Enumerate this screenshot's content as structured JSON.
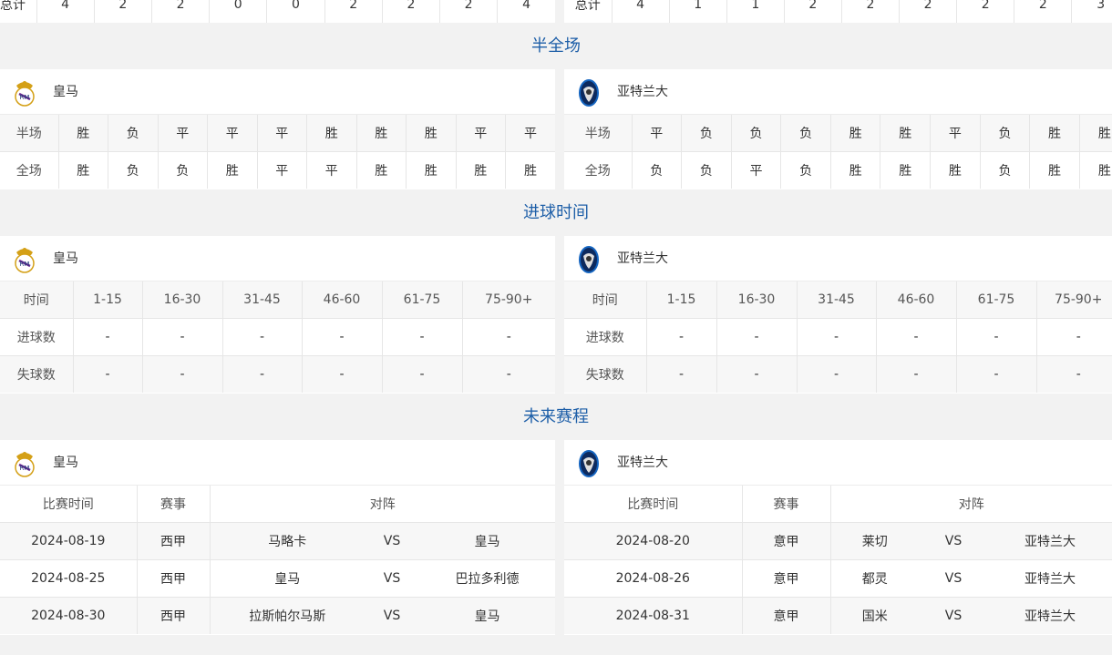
{
  "totals": {
    "left": {
      "label": "总计",
      "values": [
        "4",
        "2",
        "2",
        "0",
        "0",
        "2",
        "2",
        "2",
        "4"
      ]
    },
    "right": {
      "label": "总计",
      "values": [
        "4",
        "1",
        "1",
        "2",
        "2",
        "2",
        "2",
        "2",
        "3"
      ]
    }
  },
  "sections": {
    "halffull_title": "半全场",
    "goaltime_title": "进球时间",
    "future_title": "未来赛程"
  },
  "teams": {
    "home": {
      "name": "皇马"
    },
    "away": {
      "name": "亚特兰大"
    }
  },
  "halffull": {
    "home": {
      "half": {
        "label": "半场",
        "results": [
          "胜",
          "负",
          "平",
          "平",
          "平",
          "胜",
          "胜",
          "胜",
          "平",
          "平"
        ]
      },
      "full": {
        "label": "全场",
        "results": [
          "胜",
          "负",
          "负",
          "胜",
          "平",
          "平",
          "胜",
          "胜",
          "胜",
          "胜"
        ]
      }
    },
    "away": {
      "half": {
        "label": "半场",
        "results": [
          "平",
          "负",
          "负",
          "负",
          "胜",
          "胜",
          "平",
          "负",
          "胜",
          "胜"
        ]
      },
      "full": {
        "label": "全场",
        "results": [
          "负",
          "负",
          "平",
          "负",
          "胜",
          "胜",
          "胜",
          "负",
          "胜",
          "胜"
        ]
      }
    }
  },
  "goaltime": {
    "header": [
      "时间",
      "1-15",
      "16-30",
      "31-45",
      "46-60",
      "61-75",
      "75-90+"
    ],
    "home": {
      "scored": {
        "label": "进球数",
        "values": [
          "-",
          "-",
          "-",
          "-",
          "-",
          "-"
        ]
      },
      "conceded": {
        "label": "失球数",
        "values": [
          "-",
          "-",
          "-",
          "-",
          "-",
          "-"
        ]
      }
    },
    "away": {
      "scored": {
        "label": "进球数",
        "values": [
          "-",
          "-",
          "-",
          "-",
          "-",
          "-"
        ]
      },
      "conceded": {
        "label": "失球数",
        "values": [
          "-",
          "-",
          "-",
          "-",
          "-",
          "-"
        ]
      }
    }
  },
  "future": {
    "header": {
      "time": "比赛时间",
      "league": "赛事",
      "match": "对阵"
    },
    "home": [
      {
        "date": "2024-08-19",
        "league": "西甲",
        "team1": "马略卡",
        "vs": "VS",
        "team2": "皇马"
      },
      {
        "date": "2024-08-25",
        "league": "西甲",
        "team1": "皇马",
        "vs": "VS",
        "team2": "巴拉多利德"
      },
      {
        "date": "2024-08-30",
        "league": "西甲",
        "team1": "拉斯帕尔马斯",
        "vs": "VS",
        "team2": "皇马"
      }
    ],
    "away": [
      {
        "date": "2024-08-20",
        "league": "意甲",
        "team1": "莱切",
        "vs": "VS",
        "team2": "亚特兰大"
      },
      {
        "date": "2024-08-26",
        "league": "意甲",
        "team1": "都灵",
        "vs": "VS",
        "team2": "亚特兰大"
      },
      {
        "date": "2024-08-31",
        "league": "意甲",
        "team1": "国米",
        "vs": "VS",
        "team2": "亚特兰大"
      }
    ]
  },
  "colors": {
    "title_blue": "#1e5fa8",
    "bg_gray": "#f2f2f2"
  }
}
